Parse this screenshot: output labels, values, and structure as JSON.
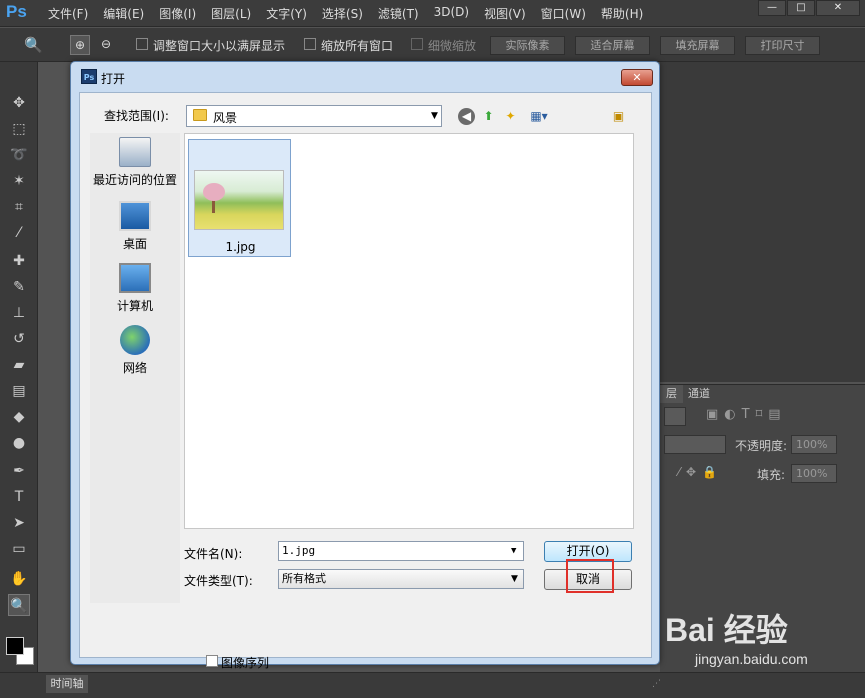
{
  "app": {
    "logo": "Ps"
  },
  "menubar": {
    "items": [
      "文件(F)",
      "编辑(E)",
      "图像(I)",
      "图层(L)",
      "文字(Y)",
      "选择(S)",
      "滤镜(T)",
      "3D(D)",
      "视图(V)",
      "窗口(W)",
      "帮助(H)"
    ]
  },
  "options": {
    "chk1_label": "调整窗口大小以满屏显示",
    "chk2_label": "缩放所有窗口",
    "chk3_label": "细微缩放",
    "actual_pixels": "实际像素",
    "fit_screen": "适合屏幕",
    "fill_screen": "填充屏幕",
    "print_size": "打印尺寸"
  },
  "panels": {
    "layers_tab": "层",
    "channels_tab": "通道",
    "opacity_label": "不透明度:",
    "opacity_value": "100%",
    "fill_label": "填充:",
    "fill_value": "100%"
  },
  "bottom": {
    "timeline_tab": "时间轴"
  },
  "dialog": {
    "title": "打开",
    "lookin_label": "查找范围(I):",
    "lookin_value": "风景",
    "places": [
      "最近访问的位置",
      "桌面",
      "计算机",
      "网络"
    ],
    "file": {
      "name": "1.jpg"
    },
    "filename_label": "文件名(N):",
    "filename_value": "1.jpg",
    "filetype_label": "文件类型(T):",
    "filetype_value": "所有格式",
    "open_button": "打开(O)",
    "cancel_button": "取消",
    "sequence_label": "图像序列"
  },
  "watermark": {
    "logo": "Bai 经验",
    "url": "jingyan.baidu.com"
  },
  "colors": {
    "ps_bg": "#535353",
    "dialog_frame": "#c9dcf1",
    "highlight": "#e0302a"
  }
}
